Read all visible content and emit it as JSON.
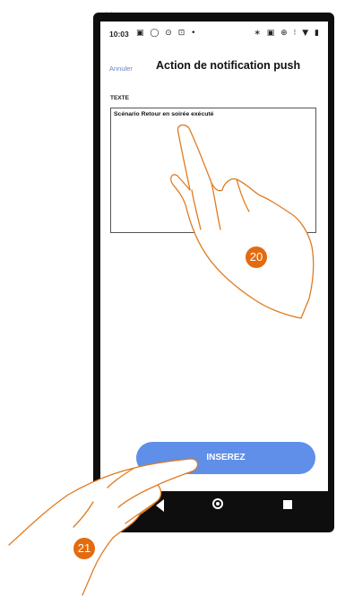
{
  "top_icons": "✕⧉",
  "status_bar": {
    "time": "10:03",
    "left_icons": "▣ ◯ ⊙ ⊡ •",
    "right_icons": "∗ ▣ ⊕ ⁝ ▼ ▮"
  },
  "header": {
    "cancel_label": "Annuler",
    "title": "Action de notification push"
  },
  "form": {
    "field_label": "TEXTE",
    "text_value": "Scénario Retour en soirée exécuté"
  },
  "insert_button_label": "INSEREZ",
  "markers": {
    "step_a": "20",
    "step_b": "21"
  },
  "colors": {
    "accent": "#5f8fe8",
    "cancel_link": "#6b7fc9",
    "marker": "#e36b10",
    "hand_outline": "#e07a1f"
  }
}
